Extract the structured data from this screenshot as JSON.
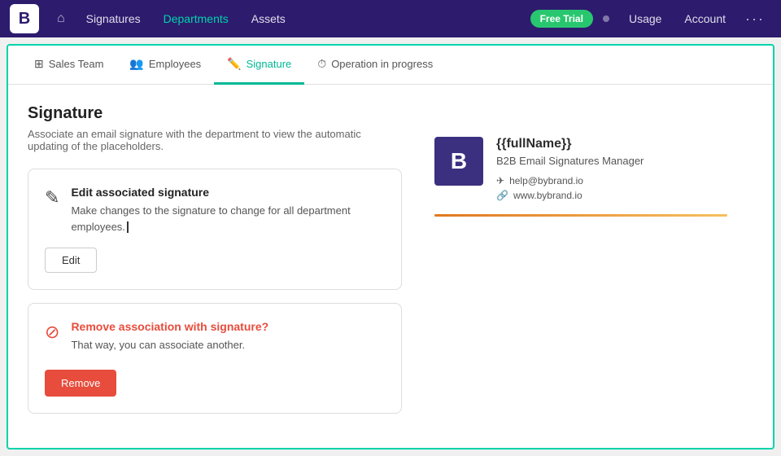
{
  "nav": {
    "logo_text": "B",
    "links": [
      {
        "label": "Signatures",
        "active": false
      },
      {
        "label": "Departments",
        "active": true
      },
      {
        "label": "Assets",
        "active": false
      }
    ],
    "free_trial_label": "Free Trial",
    "usage_label": "Usage",
    "account_label": "Account"
  },
  "tabs": [
    {
      "label": "Sales Team",
      "icon": "🏢",
      "active": false
    },
    {
      "label": "Employees",
      "icon": "👥",
      "active": false
    },
    {
      "label": "Signature",
      "icon": "✏️",
      "active": true
    },
    {
      "label": "Operation in progress",
      "icon": "⏳",
      "active": false
    }
  ],
  "page": {
    "title": "Signature",
    "subtitle": "Associate an email signature with the department to view the automatic updating of the placeholders."
  },
  "edit_card": {
    "title": "Edit associated signature",
    "description": "Make changes to the signature to change for all department employees.",
    "button_label": "Edit"
  },
  "remove_card": {
    "title": "Remove association with signature?",
    "description": "That way, you can associate another.",
    "button_label": "Remove"
  },
  "signature_preview": {
    "logo_text": "B",
    "name": "{{fullName}}",
    "job_title": "B2B Email Signatures Manager",
    "email": "help@bybrand.io",
    "website": "www.bybrand.io"
  }
}
